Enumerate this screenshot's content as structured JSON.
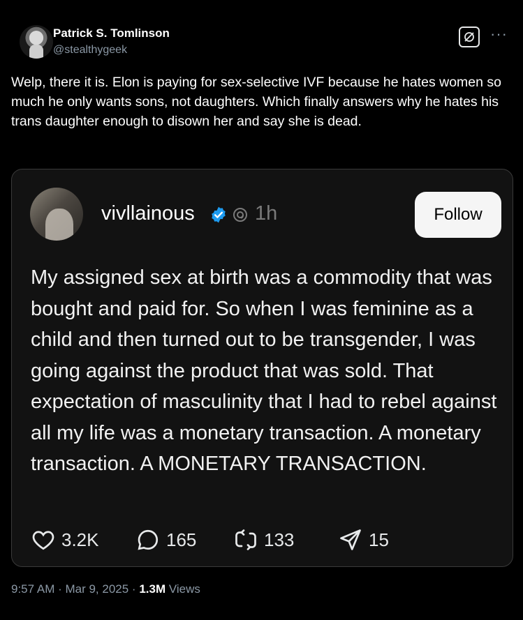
{
  "author": {
    "name": "Patrick S. Tomlinson",
    "handle": "@stealthygeek"
  },
  "post": {
    "text": "Welp, there it is. Elon is paying for sex-selective IVF because he hates women so much he only wants sons, not daughters. Which finally answers why he hates his trans daughter enough to disown her and say she is dead."
  },
  "quote": {
    "username": "vivllainous",
    "time": "1h",
    "follow_label": "Follow",
    "text": "My assigned sex at birth was a commodity that was bought and paid for. So when I was feminine as a child and then turned out to be transgender, I was going against the product that was sold. That expectation of masculinity that I had to rebel against all my life was a monetary transaction. A monetary transaction. A MONETARY TRANSACTION.",
    "actions": {
      "likes": "3.2K",
      "replies": "165",
      "reposts": "133",
      "shares": "15"
    }
  },
  "meta": {
    "timestamp": "9:57 AM · Mar 9, 2025 · ",
    "views": "1.3M",
    "views_label": " Views"
  },
  "icons": {
    "verified": "verified-badge-icon",
    "threads": "threads-logo-icon",
    "grok": "grok-icon",
    "more": "more-icon",
    "like": "heart-icon",
    "reply": "comment-icon",
    "repost": "repost-icon",
    "share": "share-icon"
  },
  "colors": {
    "verified_blue": "#1d9bf0",
    "muted": "#8b98a5",
    "card_bg": "#121212"
  }
}
